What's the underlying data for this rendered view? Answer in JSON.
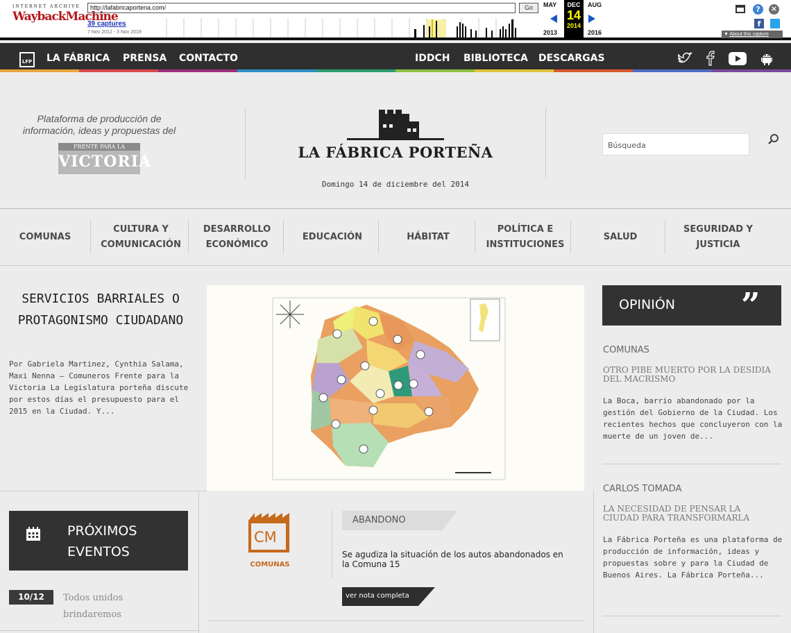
{
  "wayback": {
    "logo_top": "INTERNET ARCHIVE",
    "logo_main": "WaybackMachine",
    "url": "http://lafabricaportena.com/",
    "go_label": "Go",
    "captures": "39 captures",
    "capture_range": "7 Nov 2012 - 3 Nov 2019",
    "prev_month": "MAY",
    "current_month": "DEC",
    "next_month": "AUG",
    "current_day": "14",
    "prev_year": "2013",
    "current_year": "2014",
    "next_year": "2016",
    "about": "About this capture"
  },
  "topnav": {
    "left": [
      "LA FÁBRICA",
      "PRENSA",
      "CONTACTO"
    ],
    "center": [
      "IDDCH",
      "BIBLIOTECA",
      "DESCARGAS"
    ],
    "logo_text": "LFP"
  },
  "colors": {
    "accent_orange": "#c56a1a",
    "rainbow": [
      "#e8a53a",
      "#d9484b",
      "#9c2f7b",
      "#2e8fc7",
      "#2d9b70",
      "#8cbf3f",
      "#e0c43a",
      "#d6582e",
      "#4e6bc4",
      "#7a4b9b"
    ]
  },
  "header": {
    "tagline": "Plataforma de producción de información, ideas y propuestas del",
    "fpv_small": "FRENTE PARA LA",
    "fpv_big": "VICTORIA",
    "site_title": "LA FÁBRICA PORTEÑA",
    "site_date": "Domingo 14 de diciembre del 2014",
    "search_placeholder": "Búsqueda"
  },
  "categories": [
    "COMUNAS",
    "CULTURA Y COMUNICACIÓN",
    "DESARROLLO ECONÓMICO",
    "EDUCACIÓN",
    "HÁBITAT",
    "POLÍTICA E INSTITUCIONES",
    "SALUD",
    "SEGURIDAD Y JUSTICIA"
  ],
  "featured": {
    "title": "SERVICIOS BARRIALES O PROTAGONISMO CIUDADANO",
    "excerpt": "Por Gabriela Martinez, Cynthia Salama, Maxi Nenna — Comuneros Frente para la Victoria La Legislatura porteña discute por estos días el presupuesto para el 2015 en la Ciudad. Y..."
  },
  "opinion": {
    "header": "OPINIÓN",
    "items": [
      {
        "category": "COMUNAS",
        "title": "OTRO PIBE MUERTO POR LA DESIDIA DEL MACRISMO",
        "text": "La Boca, barrio abandonado por la gestión del Gobierno de la Ciudad. Los recientes hechos que concluyeron con la muerte de un joven de..."
      },
      {
        "category": "CARLOS TOMADA",
        "title": "LA NECESIDAD DE PENSAR LA CIUDAD PARA TRANSFORMARLA",
        "text": "La Fábrica Porteña es una plataforma de producción de información, ideas y propuestas sobre y para la Ciudad de Buenos Aires. La Fábrica Porteña..."
      }
    ]
  },
  "events": {
    "header": "PRÓXIMOS EVENTOS",
    "items": [
      {
        "date": "10/12",
        "name": "Todos unidos brindaremos"
      }
    ]
  },
  "news": {
    "badge_letters": "CM",
    "badge_label": "COMUNAS",
    "tag": "ABANDONO",
    "text": "Se agudiza la situación de los autos abandonados en la Comuna 15",
    "more": "ver nota completa"
  }
}
